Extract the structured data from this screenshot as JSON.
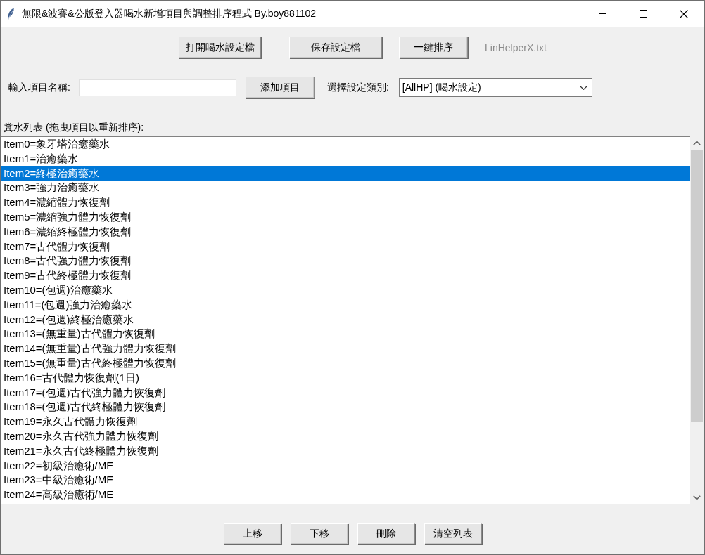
{
  "window": {
    "title": "無限&波賽&公版登入器喝水新增項目與調整排序程式 By.boy881102"
  },
  "toolbar": {
    "buttons": [
      "打開喝水設定檔",
      "保存設定檔",
      "一鍵排序"
    ],
    "file_label": "LinHelperX.txt"
  },
  "entry_row": {
    "name_label": "輸入項目名稱:",
    "add_button": "添加項目",
    "category_label": "選擇設定類別:",
    "category_select": {
      "value": "[AllHP] (喝水設定)"
    }
  },
  "list": {
    "label": "糞水列表 (拖曳項目以重新排序):",
    "items": [
      {
        "text": "Item0=象牙塔治癒藥水",
        "selected": false
      },
      {
        "text": "Item1=治癒藥水",
        "selected": false
      },
      {
        "text": "Item2=終極治癒藥水",
        "selected": true
      },
      {
        "text": "Item3=強力治癒藥水",
        "selected": false
      },
      {
        "text": "Item4=濃縮體力恢復劑",
        "selected": false
      },
      {
        "text": "Item5=濃縮強力體力恢復劑",
        "selected": false
      },
      {
        "text": "Item6=濃縮終極體力恢復劑",
        "selected": false
      },
      {
        "text": "Item7=古代體力恢復劑",
        "selected": false
      },
      {
        "text": "Item8=古代強力體力恢復劑",
        "selected": false
      },
      {
        "text": "Item9=古代終極體力恢復劑",
        "selected": false
      },
      {
        "text": "Item10=(包週)治癒藥水",
        "selected": false
      },
      {
        "text": "Item11=(包週)強力治癒藥水",
        "selected": false
      },
      {
        "text": "Item12=(包週)終極治癒藥水",
        "selected": false
      },
      {
        "text": "Item13=(無重量)古代體力恢復劑",
        "selected": false
      },
      {
        "text": "Item14=(無重量)古代強力體力恢復劑",
        "selected": false
      },
      {
        "text": "Item15=(無重量)古代終極體力恢復劑",
        "selected": false
      },
      {
        "text": "Item16=古代體力恢復劑(1日)",
        "selected": false
      },
      {
        "text": "Item17=(包週)古代強力體力恢復劑",
        "selected": false
      },
      {
        "text": "Item18=(包週)古代終極體力恢復劑",
        "selected": false
      },
      {
        "text": "Item19=永久古代體力恢復劑",
        "selected": false
      },
      {
        "text": "Item20=永久古代強力體力恢復劑",
        "selected": false
      },
      {
        "text": "Item21=永久古代終極體力恢復劑",
        "selected": false
      },
      {
        "text": "Item22=初級治癒術/ME",
        "selected": false
      },
      {
        "text": "Item23=中級治癒術/ME",
        "selected": false
      },
      {
        "text": "Item24=高級治癒術/ME",
        "selected": false
      }
    ]
  },
  "bottom_buttons": [
    "上移",
    "下移",
    "刪除",
    "清空列表"
  ]
}
